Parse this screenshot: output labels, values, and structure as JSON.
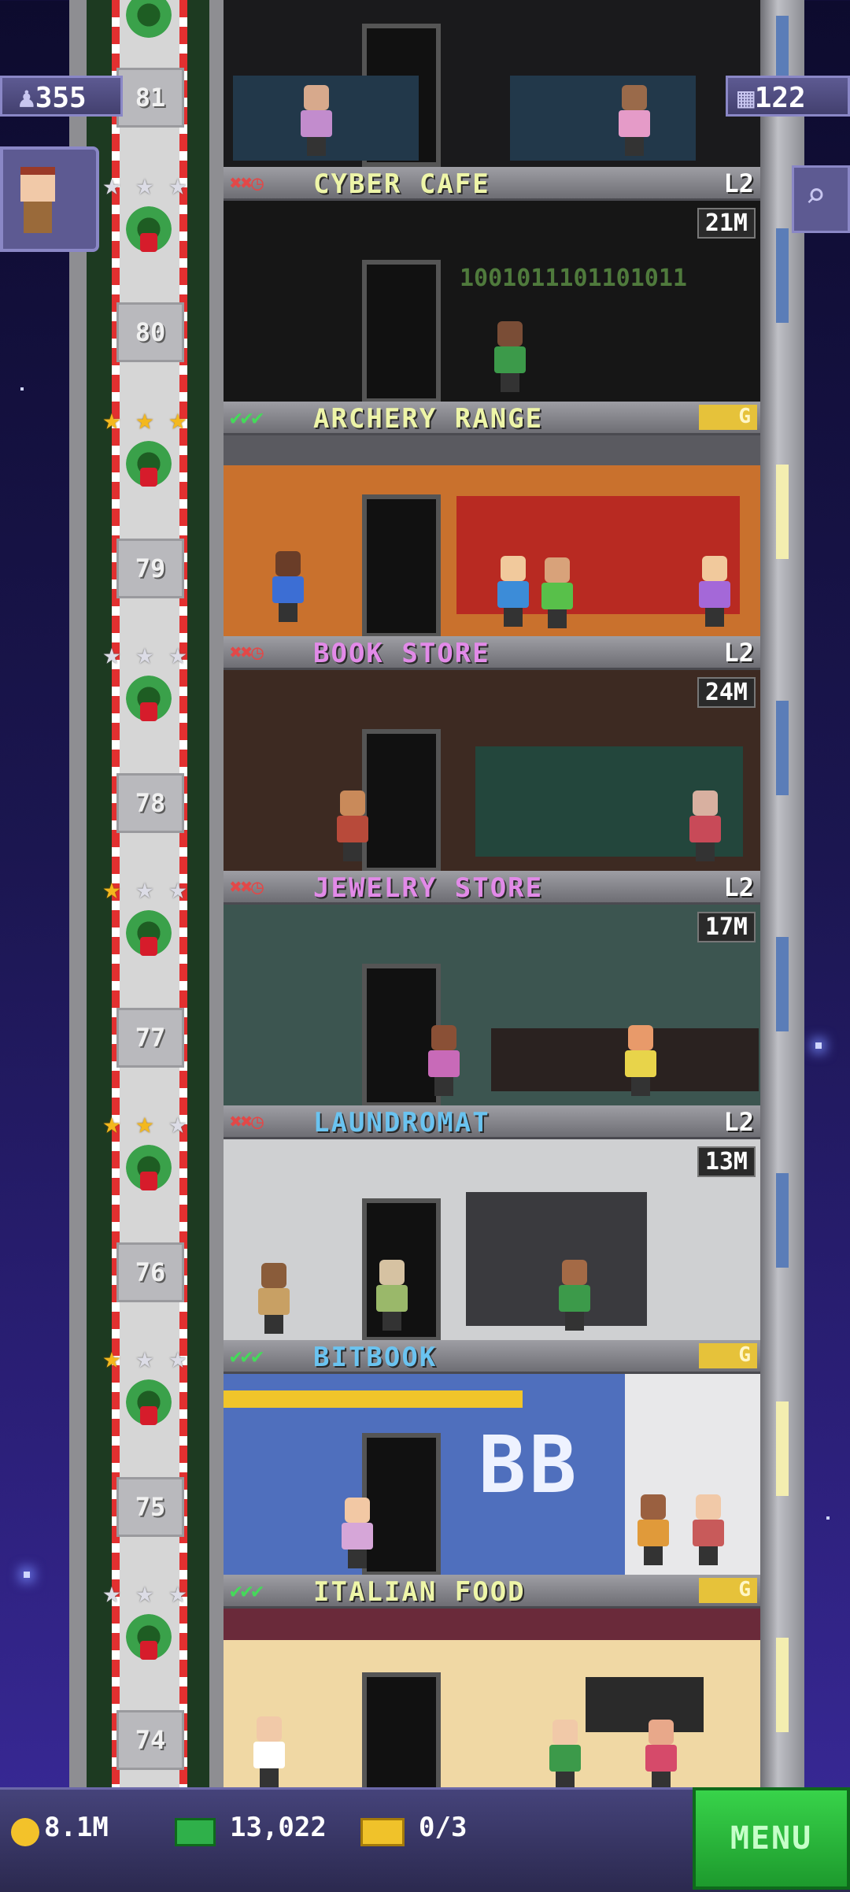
{
  "hud": {
    "population": "355",
    "floors": "122",
    "coins": "8.1M",
    "bux": "13,022",
    "tickets": "0/3",
    "menu_label": "MENU"
  },
  "colors": {
    "residential_bg": "#2b1f78",
    "accent_green": "#38d34a"
  },
  "floors": [
    {
      "number": "81",
      "name": "",
      "status_marks": "",
      "level": "",
      "timer": ""
    },
    {
      "number": "80",
      "name": "CYBER CAFE",
      "status_marks": "✖✖◷",
      "level": "L2",
      "timer": "21M",
      "stars": [
        "silver",
        "silver",
        "silver"
      ],
      "decor_text": "1001011101101011"
    },
    {
      "number": "79",
      "name": "ARCHERY RANGE",
      "status_marks": "✔✔✔",
      "level": "G",
      "timer": "",
      "stars": [
        "gold",
        "gold",
        "gold"
      ]
    },
    {
      "number": "78",
      "name": "BOOK STORE",
      "status_marks": "✖✖◷",
      "level": "L2",
      "timer": "24M",
      "stars": [
        "silver",
        "silver",
        "silver"
      ]
    },
    {
      "number": "77",
      "name": "JEWELRY STORE",
      "status_marks": "✖✖◷",
      "level": "L2",
      "timer": "17M",
      "stars": [
        "gold",
        "silver",
        "silver"
      ]
    },
    {
      "number": "76",
      "name": "LAUNDROMAT",
      "status_marks": "✖✖◷",
      "level": "L2",
      "timer": "13M",
      "stars": [
        "gold",
        "gold",
        "silver"
      ]
    },
    {
      "number": "75",
      "name": "BITBOOK",
      "status_marks": "✔✔✔",
      "level": "G",
      "timer": "",
      "stars": [
        "gold",
        "silver",
        "silver"
      ],
      "decor_text": "BB"
    },
    {
      "number": "74",
      "name": "ITALIAN FOOD",
      "status_marks": "✔✔✔",
      "level": "G",
      "timer": "",
      "stars": [
        "silver",
        "silver",
        "silver"
      ]
    }
  ]
}
